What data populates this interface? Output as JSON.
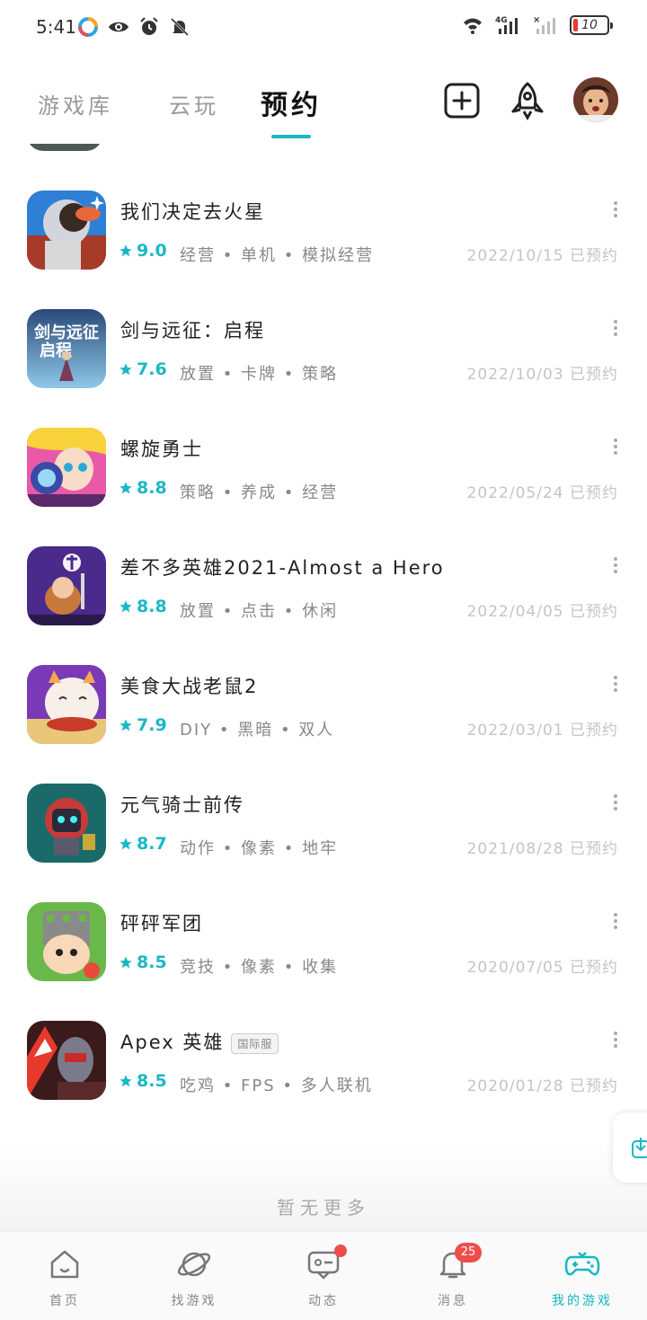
{
  "status_bar": {
    "time": "5:41",
    "battery": "10",
    "icons_left": [
      "app-icon",
      "eye-icon",
      "alarm-icon",
      "mute-bell-icon"
    ],
    "icons_right": [
      "wifi-icon",
      "signal-4g-icon",
      "signal-icon",
      "battery-icon"
    ]
  },
  "top_nav": {
    "tabs": [
      {
        "label": "游戏库"
      },
      {
        "label": "云玩"
      },
      {
        "label": "预约"
      }
    ],
    "active_tab": 2
  },
  "games": [
    {
      "title": "我们决定去火星",
      "badge": "",
      "rating": "9.0",
      "tags": "经营 • 单机 • 模拟经营",
      "date": "2022/10/15 已预约",
      "icon": "mars-astronaut"
    },
    {
      "title": "剑与远征：启程",
      "badge": "",
      "rating": "7.6",
      "tags": "放置 • 卡牌 • 策略",
      "date": "2022/10/03 已预约",
      "icon": "afk-journey"
    },
    {
      "title": "螺旋勇士",
      "badge": "",
      "rating": "8.8",
      "tags": "策略 • 养成 • 经营",
      "date": "2022/05/24 已预约",
      "icon": "spiral-hero"
    },
    {
      "title": "差不多英雄2021-Almost a Hero",
      "badge": "",
      "rating": "8.8",
      "tags": "放置 • 点击 • 休闲",
      "date": "2022/04/05 已预约",
      "icon": "almost-hero"
    },
    {
      "title": "美食大战老鼠2",
      "badge": "",
      "rating": "7.9",
      "tags": "DIY • 黑暗 • 双人",
      "date": "2022/03/01 已预约",
      "icon": "food-cat"
    },
    {
      "title": "元气骑士前传",
      "badge": "",
      "rating": "8.7",
      "tags": "动作 • 像素 • 地牢",
      "date": "2021/08/28 已预约",
      "icon": "soul-knight"
    },
    {
      "title": "砰砰军团",
      "badge": "",
      "rating": "8.5",
      "tags": "竞技 • 像素 • 收集",
      "date": "2020/07/05 已预约",
      "icon": "pengpeng"
    },
    {
      "title": "Apex 英雄",
      "badge": "国际服",
      "rating": "8.5",
      "tags": "吃鸡 • FPS • 多人联机",
      "date": "2020/01/28 已预约",
      "icon": "apex"
    }
  ],
  "footer_text": "暂无更多",
  "bottom_nav": [
    {
      "label": "首页",
      "icon": "home-icon"
    },
    {
      "label": "找游戏",
      "icon": "planet-icon"
    },
    {
      "label": "动态",
      "icon": "chat-icon",
      "dot": true
    },
    {
      "label": "消息",
      "icon": "bell-icon",
      "badge": "25"
    },
    {
      "label": "我的游戏",
      "icon": "gamepad-icon"
    }
  ],
  "colors": {
    "accent": "#14b7c2",
    "rating": "#1bb8c4",
    "badge_red": "#ef4c4c"
  }
}
